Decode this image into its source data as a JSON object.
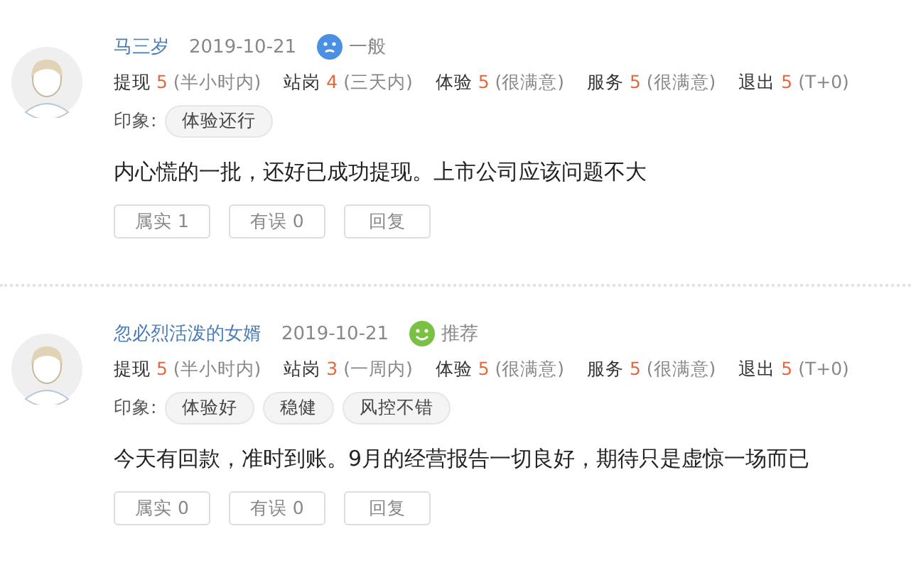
{
  "reviews": [
    {
      "user": "马三岁",
      "date": "2019-10-21",
      "mood": {
        "kind": "neutral",
        "label": "一般"
      },
      "scores": [
        {
          "label": "提现",
          "value": "5",
          "note": "(半小时内)"
        },
        {
          "label": "站岗",
          "value": "4",
          "note": "(三天内)"
        },
        {
          "label": "体验",
          "value": "5",
          "note": "(很满意)"
        },
        {
          "label": "服务",
          "value": "5",
          "note": "(很满意)"
        },
        {
          "label": "退出",
          "value": "5",
          "note": "(T+0)"
        }
      ],
      "impression_label": "印象:",
      "tags": [
        "体验还行"
      ],
      "text": "内心慌的一批，还好已成功提现。上市公司应该问题不大",
      "buttons": [
        "属实 1",
        "有误 0",
        "回复"
      ]
    },
    {
      "user": "忽必烈活泼的女婿",
      "date": "2019-10-21",
      "mood": {
        "kind": "happy",
        "label": "推荐"
      },
      "scores": [
        {
          "label": "提现",
          "value": "5",
          "note": "(半小时内)"
        },
        {
          "label": "站岗",
          "value": "3",
          "note": "(一周内)"
        },
        {
          "label": "体验",
          "value": "5",
          "note": "(很满意)"
        },
        {
          "label": "服务",
          "value": "5",
          "note": "(很满意)"
        },
        {
          "label": "退出",
          "value": "5",
          "note": "(T+0)"
        }
      ],
      "impression_label": "印象:",
      "tags": [
        "体验好",
        "稳健",
        "风控不错"
      ],
      "text": "今天有回款，准时到账。9月的经营报告一切良好，期待只是虚惊一场而已",
      "buttons": [
        "属实 0",
        "有误 0",
        "回复"
      ]
    }
  ]
}
